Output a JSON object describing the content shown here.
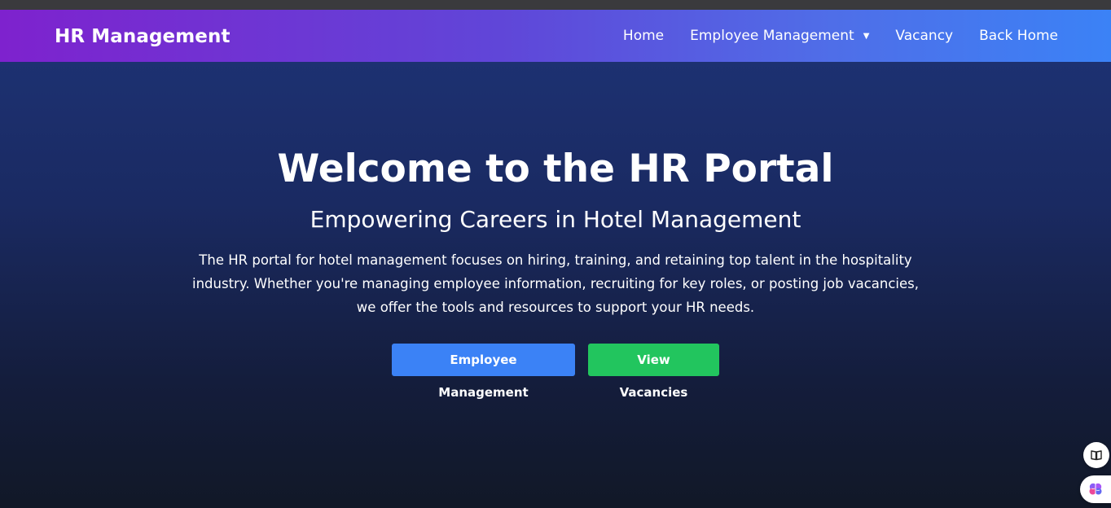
{
  "navbar": {
    "brand": "HR Management",
    "links": [
      {
        "label": "Home"
      },
      {
        "label": "Employee Management",
        "has_dropdown": true,
        "caret": "▼"
      },
      {
        "label": "Vacancy"
      },
      {
        "label": "Back Home"
      }
    ],
    "gradient_start": "#7e22ce",
    "gradient_end": "#3b82f6"
  },
  "hero": {
    "title": "Welcome to the HR Portal",
    "subtitle": "Empowering Careers in Hotel Management",
    "description": "The HR portal for hotel management focuses on hiring, training, and retaining top talent in the hospitality industry. Whether you're managing employee information, recruiting for key roles, or posting job vacancies, we offer the tools and resources to support your HR needs.",
    "buttons": [
      {
        "label": "Employee Management",
        "color": "#3b82f6"
      },
      {
        "label": "View Vacancies",
        "color": "#22c55e"
      }
    ]
  },
  "floating": {
    "book_icon": "book-icon",
    "brain_icon": "brain-icon"
  }
}
